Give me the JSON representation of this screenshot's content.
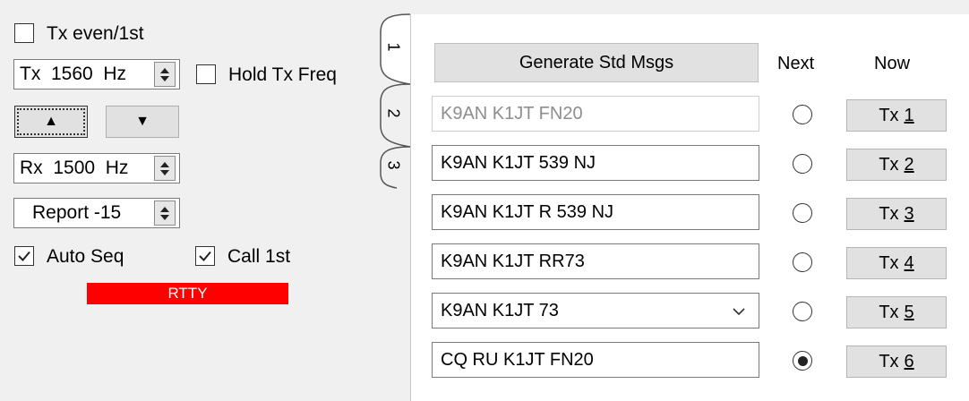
{
  "left": {
    "tx_even_label": "Tx even/1st",
    "tx_even_checked": false,
    "tx_freq": "Tx  1560  Hz",
    "hold_tx_label": "Hold Tx Freq",
    "hold_tx_checked": false,
    "rx_freq": "Rx  1500  Hz",
    "report": "Report -15",
    "auto_seq_label": "Auto Seq",
    "auto_seq_checked": true,
    "call_1st_label": "Call 1st",
    "call_1st_checked": true,
    "mode_badge": "RTTY",
    "mode_badge_color": "#ff0000"
  },
  "tabs": [
    {
      "label": "1",
      "active": true
    },
    {
      "label": "2",
      "active": false
    },
    {
      "label": "3",
      "active": false
    }
  ],
  "main": {
    "generate_label": "Generate Std Msgs",
    "next_header": "Next",
    "now_header": "Now",
    "rows": [
      {
        "message": "K9AN K1JT FN20",
        "disabled": true,
        "next_selected": false,
        "tx_prefix": "Tx",
        "tx_num": "1"
      },
      {
        "message": "K9AN K1JT 539 NJ",
        "disabled": false,
        "next_selected": false,
        "tx_prefix": "Tx",
        "tx_num": "2"
      },
      {
        "message": "K9AN K1JT R 539 NJ",
        "disabled": false,
        "next_selected": false,
        "tx_prefix": "Tx",
        "tx_num": "3"
      },
      {
        "message": "K9AN K1JT RR73",
        "disabled": false,
        "next_selected": false,
        "tx_prefix": "Tx",
        "tx_num": "4"
      },
      {
        "message": "K9AN K1JT 73",
        "disabled": false,
        "dropdown": true,
        "next_selected": false,
        "tx_prefix": "Tx",
        "tx_num": "5"
      },
      {
        "message": "CQ RU K1JT FN20",
        "disabled": false,
        "next_selected": true,
        "tx_prefix": "Tx",
        "tx_num": "6"
      }
    ]
  }
}
